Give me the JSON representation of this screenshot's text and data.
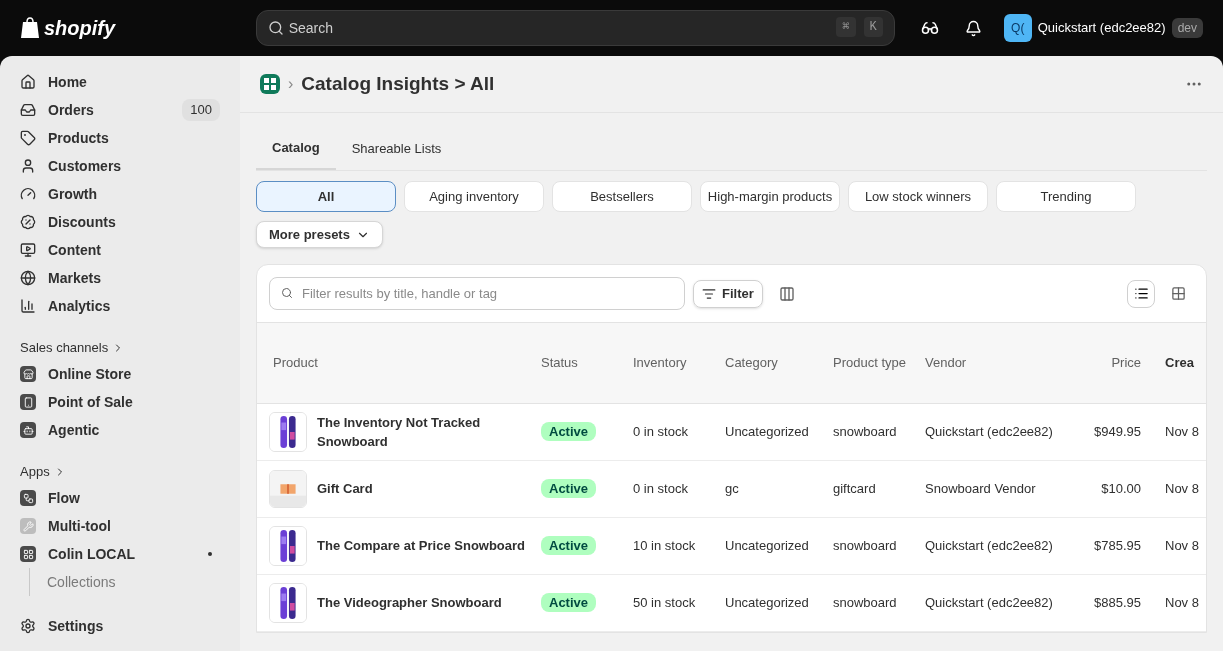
{
  "topbar": {
    "logo": "shopify",
    "search": {
      "placeholder": "Search",
      "keys": [
        "⌘",
        "K"
      ]
    },
    "store": {
      "avatar": "Q(",
      "name": "Quickstart (edc2ee82)",
      "badge": "dev"
    }
  },
  "sidebar": {
    "main": [
      {
        "label": "Home"
      },
      {
        "label": "Orders",
        "badge": "100"
      },
      {
        "label": "Products"
      },
      {
        "label": "Customers"
      },
      {
        "label": "Growth"
      },
      {
        "label": "Discounts"
      },
      {
        "label": "Content"
      },
      {
        "label": "Markets"
      },
      {
        "label": "Analytics"
      }
    ],
    "sections": [
      {
        "title": "Sales channels",
        "items": [
          {
            "label": "Online Store"
          },
          {
            "label": "Point of Sale"
          },
          {
            "label": "Agentic"
          }
        ]
      },
      {
        "title": "Apps",
        "items": [
          {
            "label": "Flow"
          },
          {
            "label": "Multi-tool"
          },
          {
            "label": "Colin LOCAL",
            "dot": true,
            "children": [
              {
                "label": "Collections"
              }
            ]
          }
        ]
      }
    ],
    "settings": "Settings"
  },
  "page": {
    "title": "Catalog Insights > All",
    "breadcrumb_sep": "›",
    "tabs": [
      {
        "label": "Catalog",
        "selected": true
      },
      {
        "label": "Shareable Lists",
        "selected": false
      }
    ],
    "presets": [
      {
        "label": "All",
        "selected": true
      },
      {
        "label": "Aging inventory",
        "selected": false
      },
      {
        "label": "Bestsellers",
        "selected": false
      },
      {
        "label": "High-margin products",
        "selected": false
      },
      {
        "label": "Low stock winners",
        "selected": false
      },
      {
        "label": "Trending",
        "selected": false
      }
    ],
    "more_presets": "More presets",
    "filter": {
      "placeholder": "Filter results by title, handle or tag",
      "button": "Filter"
    },
    "table": {
      "columns": [
        "Product",
        "Status",
        "Inventory",
        "Category",
        "Product type",
        "Vendor",
        "Price",
        "Crea"
      ],
      "rows": [
        {
          "kind": "board",
          "product": "The Inventory Not Tracked Snowboard",
          "status": "Active",
          "inventory": "0 in stock",
          "category": "Uncategorized",
          "type": "snowboard",
          "vendor": "Quickstart (edc2ee82)",
          "price": "$949.95",
          "created": "Nov 8"
        },
        {
          "kind": "card",
          "product": "Gift Card",
          "status": "Active",
          "inventory": "0 in stock",
          "category": "gc",
          "type": "giftcard",
          "vendor": "Snowboard Vendor",
          "price": "$10.00",
          "created": "Nov 8"
        },
        {
          "kind": "board",
          "product": "The Compare at Price Snowboard",
          "status": "Active",
          "inventory": "10 in stock",
          "category": "Uncategorized",
          "type": "snowboard",
          "vendor": "Quickstart (edc2ee82)",
          "price": "$785.95",
          "created": "Nov 8"
        },
        {
          "kind": "board",
          "product": "The Videographer Snowboard",
          "status": "Active",
          "inventory": "50 in stock",
          "category": "Uncategorized",
          "type": "snowboard",
          "vendor": "Quickstart (edc2ee82)",
          "price": "$885.95",
          "created": "Nov 8"
        }
      ]
    }
  }
}
